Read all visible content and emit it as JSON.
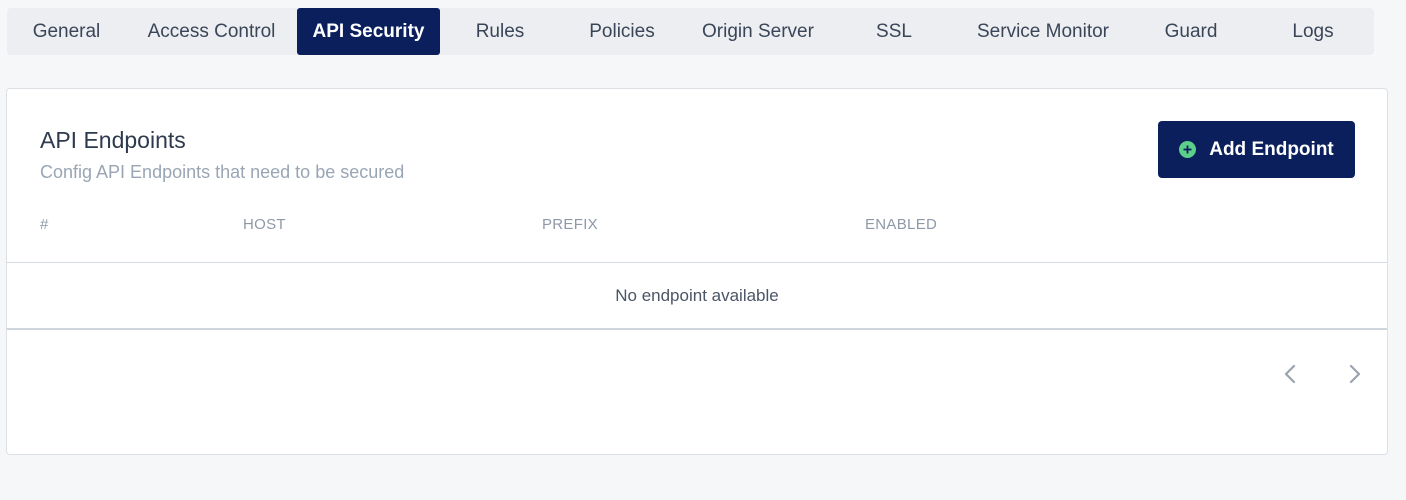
{
  "tabs": [
    {
      "label": "General",
      "active": false
    },
    {
      "label": "Access Control",
      "active": false
    },
    {
      "label": "API Security",
      "active": true
    },
    {
      "label": "Rules",
      "active": false
    },
    {
      "label": "Policies",
      "active": false
    },
    {
      "label": "Origin Server",
      "active": false
    },
    {
      "label": "SSL",
      "active": false
    },
    {
      "label": "Service Monitor",
      "active": false
    },
    {
      "label": "Guard",
      "active": false
    },
    {
      "label": "Logs",
      "active": false
    }
  ],
  "card": {
    "title": "API Endpoints",
    "subtitle": "Config API Endpoints that need to be secured",
    "add_button_label": "Add Endpoint",
    "add_button_icon": "plus-circle-icon"
  },
  "table": {
    "columns": [
      "#",
      "HOST",
      "PREFIX",
      "ENABLED"
    ],
    "empty_message": "No endpoint available"
  },
  "pagination": {
    "prev_icon": "chevron-left-icon",
    "next_icon": "chevron-right-icon"
  },
  "colors": {
    "accent": "#0a1f5c",
    "icon_green": "#5ccf8a",
    "muted_text": "#9aa5b4"
  }
}
